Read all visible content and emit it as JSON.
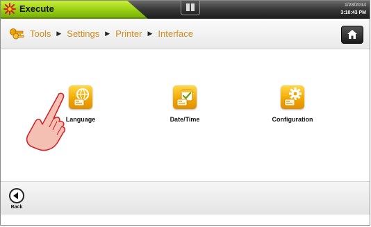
{
  "status": {
    "label": "Execute",
    "color": "#9ad013"
  },
  "datetime": {
    "date": "1/28/2014",
    "time": "3:10:43 PM"
  },
  "breadcrumb": {
    "icon": "keys-icon",
    "items": [
      "Tools",
      "Settings",
      "Printer",
      "Interface"
    ]
  },
  "tiles": [
    {
      "label": "Language",
      "icon": "globe-icon"
    },
    {
      "label": "Date/Time",
      "icon": "calendar-check-icon"
    },
    {
      "label": "Configuration",
      "icon": "gear-icon"
    }
  ],
  "footer": {
    "back_label": "Back"
  },
  "colors": {
    "accent": "#f0a600",
    "breadcrumb_text": "#d08a1c"
  }
}
